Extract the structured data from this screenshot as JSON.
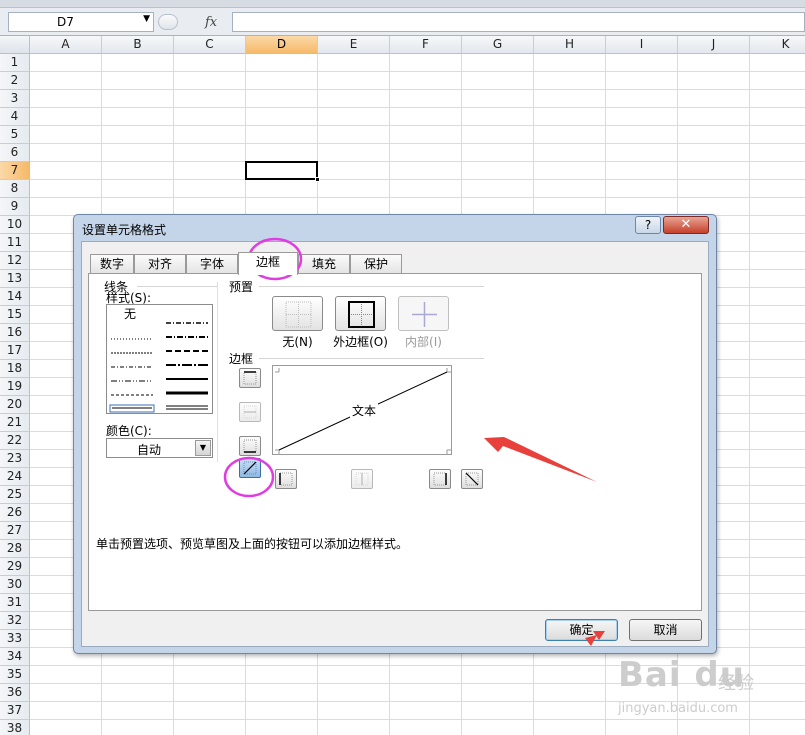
{
  "formula_bar": {
    "name_box": "D7",
    "fx_label": "fx"
  },
  "columns": [
    "A",
    "B",
    "C",
    "D",
    "E",
    "F",
    "G",
    "H",
    "I",
    "J",
    "K"
  ],
  "selected_column": "D",
  "rows": [
    "1",
    "2",
    "3",
    "4",
    "5",
    "6",
    "7",
    "8",
    "9",
    "10",
    "11",
    "12",
    "13",
    "14",
    "15",
    "16",
    "17",
    "18",
    "19",
    "20",
    "21",
    "22",
    "23",
    "24",
    "25",
    "26",
    "27",
    "28",
    "29",
    "30",
    "31",
    "32",
    "33",
    "34",
    "35",
    "36",
    "37",
    "38"
  ],
  "selected_row": "7",
  "dialog": {
    "title": "设置单元格格式",
    "help_label": "?",
    "close_label": "✕",
    "tabs": [
      {
        "label": "数字",
        "active": false
      },
      {
        "label": "对齐",
        "active": false
      },
      {
        "label": "字体",
        "active": false
      },
      {
        "label": "边框",
        "active": true
      },
      {
        "label": "填充",
        "active": false
      },
      {
        "label": "保护",
        "active": false
      }
    ],
    "line_section": "线条",
    "style_label": "样式(S):",
    "style_none": "无",
    "color_label": "颜色(C):",
    "color_value": "自动",
    "preset_section": "预置",
    "presets": [
      {
        "label": "无(N)",
        "enabled": true
      },
      {
        "label": "外边框(O)",
        "enabled": true
      },
      {
        "label": "内部(I)",
        "enabled": false
      }
    ],
    "border_section": "边框",
    "preview_text": "文本",
    "hint": "单击预置选项、预览草图及上面的按钮可以添加边框样式。",
    "ok_label": "确定",
    "cancel_label": "取消"
  },
  "annotation_colors": {
    "circle": "#e03de0",
    "arrow": "#e8403a"
  },
  "watermark": {
    "logo": "Bai du",
    "brand": "经验",
    "url": "jingyan.baidu.com"
  }
}
